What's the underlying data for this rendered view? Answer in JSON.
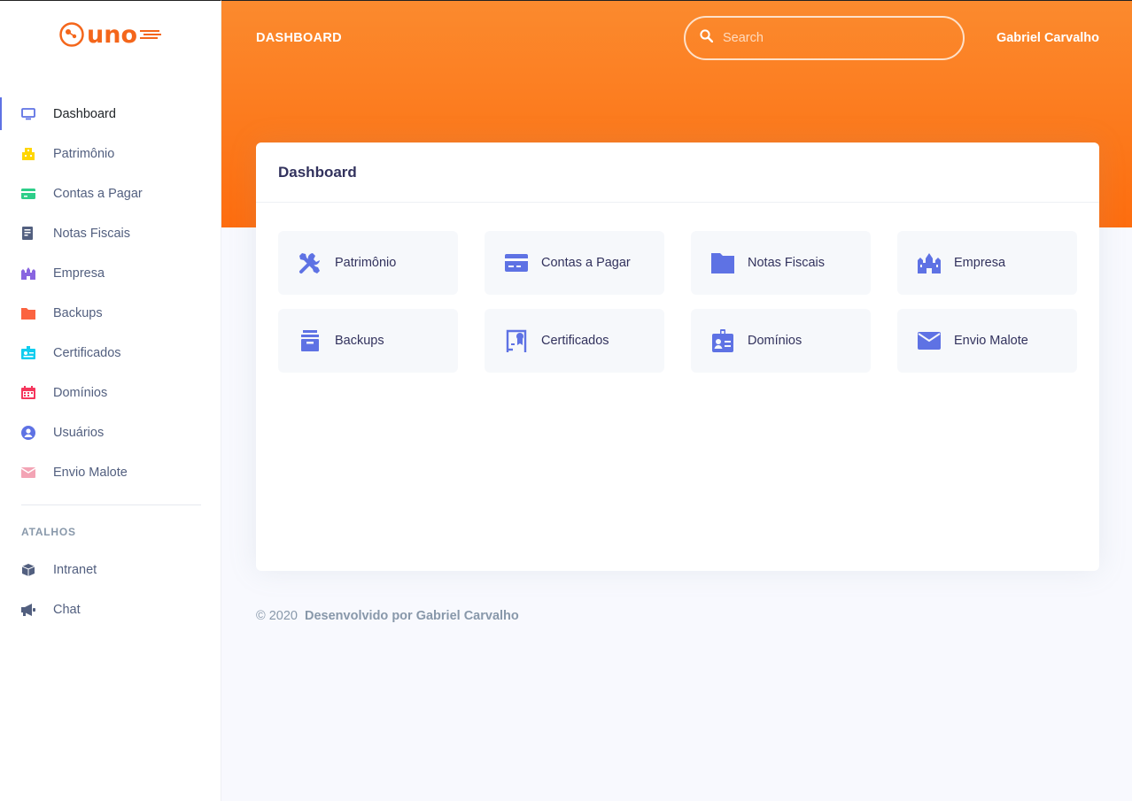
{
  "brand": {
    "logo_text": "uno",
    "accent": "#f4661b"
  },
  "header": {
    "title": "DASHBOARD",
    "user_name": "Gabriel Carvalho",
    "gradient": [
      "#fb8a2e",
      "#fd6d0f"
    ]
  },
  "search": {
    "placeholder": "Search",
    "value": ""
  },
  "sidebar": {
    "items": [
      {
        "label": "Dashboard",
        "icon": "monitor-icon",
        "color": "#5e72e4",
        "active": true
      },
      {
        "label": "Patrimônio",
        "icon": "building-icon",
        "color": "#ffd600",
        "active": false
      },
      {
        "label": "Contas a Pagar",
        "icon": "credit-card-icon",
        "color": "#2dce89",
        "active": false
      },
      {
        "label": "Notas Fiscais",
        "icon": "document-icon",
        "color": "#525f7f",
        "active": false
      },
      {
        "label": "Empresa",
        "icon": "castle-icon",
        "color": "#8965e0",
        "active": false
      },
      {
        "label": "Backups",
        "icon": "folder-icon",
        "color": "#fb6340",
        "active": false
      },
      {
        "label": "Certificados",
        "icon": "badge-icon",
        "color": "#11cdef",
        "active": false
      },
      {
        "label": "Domínios",
        "icon": "calendar-icon",
        "color": "#f5365c",
        "active": false
      },
      {
        "label": "Usuários",
        "icon": "user-icon",
        "color": "#5e72e4",
        "active": false
      },
      {
        "label": "Envio Malote",
        "icon": "envelope-icon",
        "color": "#f3a4b5",
        "active": false
      }
    ],
    "section_title": "ATALHOS",
    "shortcuts": [
      {
        "label": "Intranet",
        "icon": "box-icon",
        "color": "#525f7f"
      },
      {
        "label": "Chat",
        "icon": "megaphone-icon",
        "color": "#525f7f"
      }
    ]
  },
  "card": {
    "title": "Dashboard",
    "icon_color": "#5e72e4",
    "tiles": [
      {
        "label": "Patrimônio",
        "icon": "tools-icon"
      },
      {
        "label": "Contas a Pagar",
        "icon": "credit-card-icon"
      },
      {
        "label": "Notas Fiscais",
        "icon": "folder-icon"
      },
      {
        "label": "Empresa",
        "icon": "castle-icon"
      },
      {
        "label": "Backups",
        "icon": "archive-icon"
      },
      {
        "label": "Certificados",
        "icon": "certificate-icon"
      },
      {
        "label": "Domínios",
        "icon": "id-card-icon"
      },
      {
        "label": "Envio Malote",
        "icon": "envelope-icon"
      }
    ]
  },
  "footer": {
    "copyright": "© 2020",
    "credit": "Desenvolvido por Gabriel Carvalho"
  }
}
